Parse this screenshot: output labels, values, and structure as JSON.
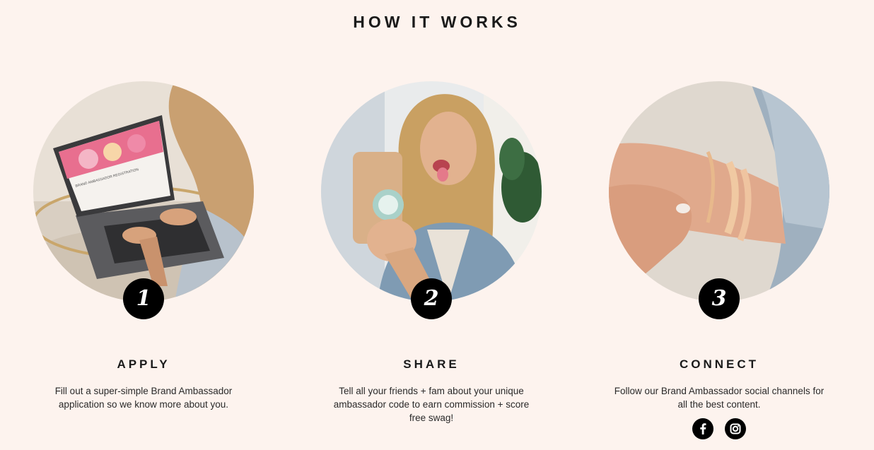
{
  "header": {
    "title": "HOW IT WORKS"
  },
  "steps": [
    {
      "number": "1",
      "title": "APPLY",
      "description": "Fill out a super-simple Brand Ambassador application so we know more about you.",
      "laptop_screen_text": "BRAND AMBASSADOR REGISTRATION"
    },
    {
      "number": "2",
      "title": "SHARE",
      "description": "Tell all your friends + fam about your unique ambassador code to earn commission + score free swag!"
    },
    {
      "number": "3",
      "title": "CONNECT",
      "description": "Follow our Brand Ambassador social channels for all the best content."
    }
  ],
  "social": {
    "icons": [
      "facebook-icon",
      "instagram-icon"
    ]
  },
  "colors": {
    "background": "#fdf3ee",
    "badge": "#000000",
    "text": "#1a1a1a"
  }
}
